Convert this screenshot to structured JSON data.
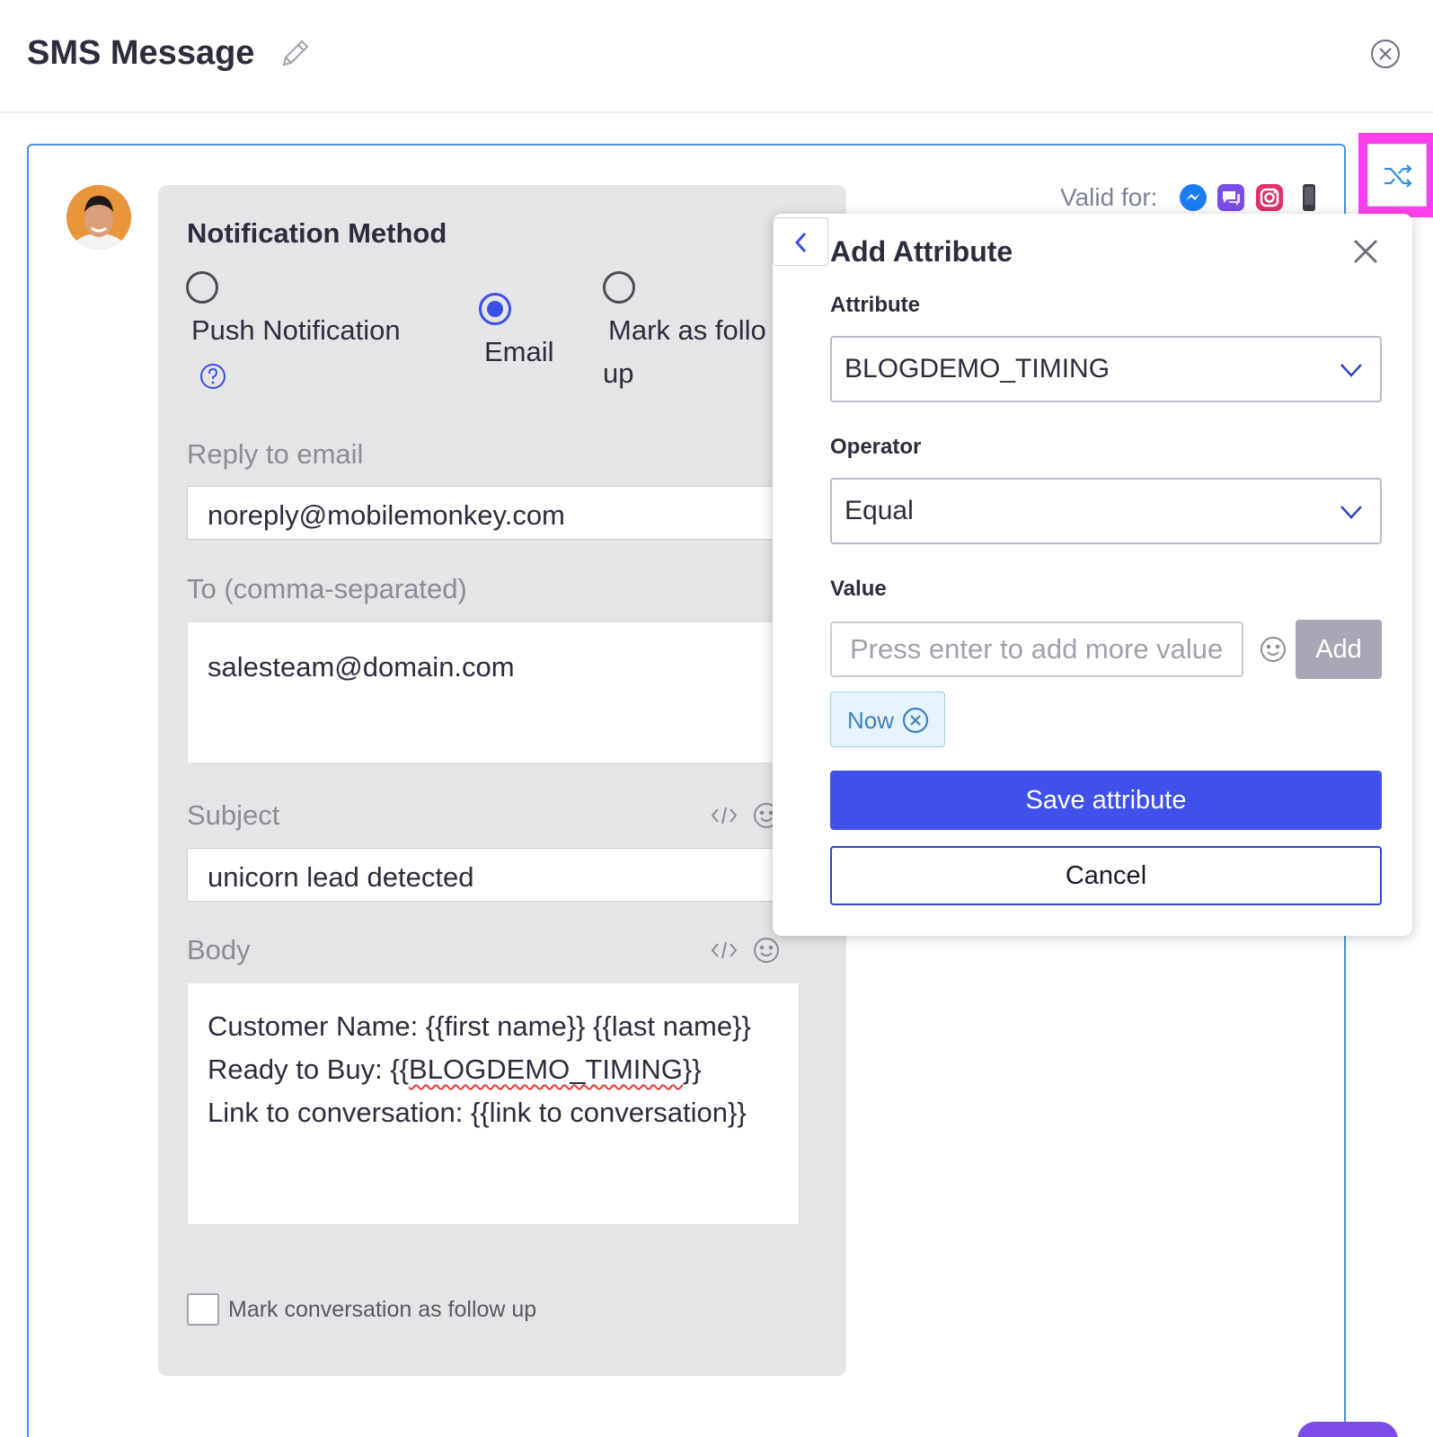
{
  "header": {
    "title": "SMS Message"
  },
  "valid_for": {
    "label": "Valid for:",
    "channels": [
      "messenger-icon",
      "chat-icon",
      "instagram-icon",
      "phone-icon"
    ]
  },
  "notification": {
    "title": "Notification Method",
    "options": [
      {
        "label": "Push Notification",
        "selected": false
      },
      {
        "label": "Email",
        "selected": true
      },
      {
        "label_line1": "Mark as follo",
        "label_line2": "up",
        "selected": false
      }
    ]
  },
  "reply_to": {
    "label": "Reply to email",
    "value": "noreply@mobilemonkey.com"
  },
  "to": {
    "label": "To (comma-separated)",
    "value": "salesteam@domain.com"
  },
  "subject": {
    "label": "Subject",
    "value": "unicorn lead detected"
  },
  "body": {
    "label": "Body",
    "line1": "Customer Name: {{first name}} {{last name}}",
    "line2_prefix": "Ready to Buy: {{",
    "line2_attr": "BLOGDEMO_TIMING",
    "line2_suffix": "}}",
    "line3": "Link to conversation: {{link to conversation}}"
  },
  "follow_up": {
    "label": "Mark conversation as follow up",
    "checked": false
  },
  "popup": {
    "title": "Add Attribute",
    "attribute_label": "Attribute",
    "attribute_value": "BLOGDEMO_TIMING",
    "operator_label": "Operator",
    "operator_value": "Equal",
    "value_label": "Value",
    "value_placeholder": "Press enter to add more values",
    "add_label": "Add",
    "tags": [
      "Now"
    ],
    "save_label": "Save attribute",
    "cancel_label": "Cancel"
  },
  "colors": {
    "primary": "#3f51ea",
    "highlight": "#ff3fee",
    "canvas_border": "#4a90e2",
    "tag_text": "#3b82c4"
  }
}
